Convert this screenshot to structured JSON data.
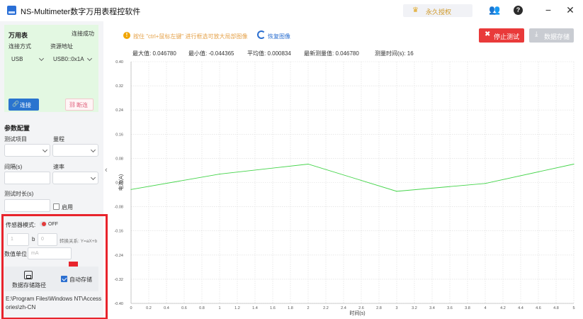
{
  "app": {
    "title": "NS-Multimeter数字万用表程控软件",
    "license_label": "永久授权"
  },
  "connection": {
    "heading": "万用表",
    "status": "连接成功",
    "method_label": "连接方式",
    "resource_label": "资源地址",
    "method_value": "USB",
    "resource_value": "USB0::0x1A",
    "connect_label": "连接",
    "disconnect_label": "断连"
  },
  "params": {
    "heading": "参数配置",
    "test_item_label": "测试项目",
    "range_label": "量程",
    "interval_label": "间隔(s)",
    "rate_label": "速率",
    "duration_label": "测试时长(s)",
    "enable_label": "启用",
    "sensor_mode_label": "传感器模式:",
    "sensor_mode_state": "OFF",
    "coef_a": "1",
    "coef_b_label": "b",
    "coef_b": "0",
    "transform_label": "转换关系: Y=aX+b",
    "unit_label": "数值单位",
    "unit_placeholder": "mA",
    "save_path_label": "数据存储路径",
    "auto_save_label": "自动存储",
    "save_path_value": "E:\\Program Files\\Windows NT\\Accessories\\zh-CN"
  },
  "toolbar": {
    "hint": "按住 \"ctrl+鼠标左键\" 进行框选可放大局部图像",
    "restore_label": "恢复图像",
    "stop_label": "停止测试",
    "save_label": "数据存储"
  },
  "stats": {
    "max": "最大值: 0.046780",
    "min": "最小值: -0.044365",
    "avg": "平均值: 0.000834",
    "latest": "最新测量值: 0.046780",
    "time": "测量时间(s): 16"
  },
  "chart_data": {
    "type": "line",
    "xlabel": "时间(s)",
    "ylabel": "电流(A)",
    "xlim": [
      0,
      5
    ],
    "ylim": [
      -0.4,
      0.4
    ],
    "x_ticks": [
      0,
      0.2,
      0.4,
      0.6,
      0.8,
      1,
      1.2,
      1.4,
      1.6,
      1.8,
      2,
      2.2,
      2.4,
      2.6,
      2.8,
      3,
      3.2,
      3.4,
      3.6,
      3.8,
      4,
      4.2,
      4.4,
      4.6,
      4.8,
      5
    ],
    "y_ticks": [
      -0.4,
      -0.32,
      -0.24,
      -0.16,
      -0.08,
      0.0,
      0.08,
      0.16,
      0.24,
      0.32,
      0.4
    ],
    "x_tick_labels": [
      "0",
      "0.2",
      "0.4",
      "0.6",
      "0.8",
      "1",
      "1.2",
      "1.4",
      "1.6",
      "1.8",
      "2",
      "2.2",
      "2.4",
      "2.6",
      "2.8",
      "3",
      "3.2",
      "3.4",
      "3.6",
      "3.8",
      "4",
      "4.2",
      "4.4",
      "4.6",
      "4.8",
      "5"
    ],
    "y_tick_labels": [
      "-0.40",
      "-0.32",
      "-0.24",
      "-0.16",
      "-0.08",
      "0.00",
      "0.08",
      "0.16",
      "0.24",
      "0.32",
      "0.40"
    ],
    "series": [
      {
        "color": "#44d44a",
        "x": [
          0,
          1,
          2,
          3,
          4,
          5
        ],
        "y": [
          -0.023,
          0.028,
          0.061,
          -0.029,
          -0.003,
          0.061
        ]
      }
    ],
    "grid": true
  }
}
